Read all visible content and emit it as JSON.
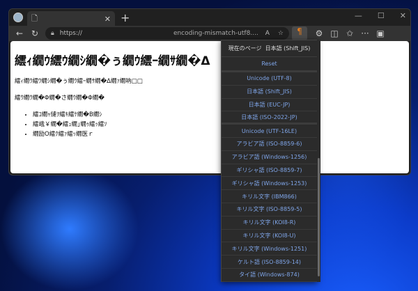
{
  "browser": {
    "url_scheme": "https://",
    "url_host": "encoding-mismatch-utf8....",
    "tab_title": ""
  },
  "page": {
    "heading": "繧ｨ繝ｳ繧ｳ繝ｼ繝�ぅ繝ｳ繧ｰ繝ｻ繝�Δ",
    "paragraph1": "繧ｨ繝ｳ繧ｳ繝ｼ繝�ぅ繝ｳ繧ｰ繝ｻ繝�Δ繝ｧ繝吶□□",
    "paragraph2": "繧ｳ繝ｳ繝�Φ繝�さ繝ｳ繝�Φ繝�",
    "list": [
      "繧ｺ繝ｬ縺ｦ繧ｷ繧ｹ繝�Β繝ｼ",
      "繧峨￥繝�繧ｭ繝｣繝ｩ繧ｯ繧ｿ",
      "繝励Ο繧ｸ繧ｧ繧ｯ繝医ｒ"
    ]
  },
  "encoding_menu": {
    "current_label": "現在のページ",
    "current_value": "日本語 (Shift_JIS)",
    "reset": "Reset",
    "items": [
      "Unicode (UTF-8)",
      "日本語 (Shift_JIS)",
      "日本語 (EUC-JP)",
      "日本語 (ISO-2022-JP)",
      "Unicode (UTF-16LE)",
      "アラビア語 (ISO-8859-6)",
      "アラビア語 (Windows-1256)",
      "ギリシャ語 (ISO-8859-7)",
      "ギリシャ語 (Windows-1253)",
      "キリル文字 (IBM866)",
      "キリル文字 (ISO-8859-5)",
      "キリル文字 (KOI8-R)",
      "キリル文字 (KOI8-U)",
      "キリル文字 (Windows-1251)",
      "ケルト語 (ISO-8859-14)",
      "タイ語 (Windows-874)"
    ]
  },
  "colors": {
    "accent": "#e07b1f",
    "menu_text": "#7fa5e8"
  }
}
